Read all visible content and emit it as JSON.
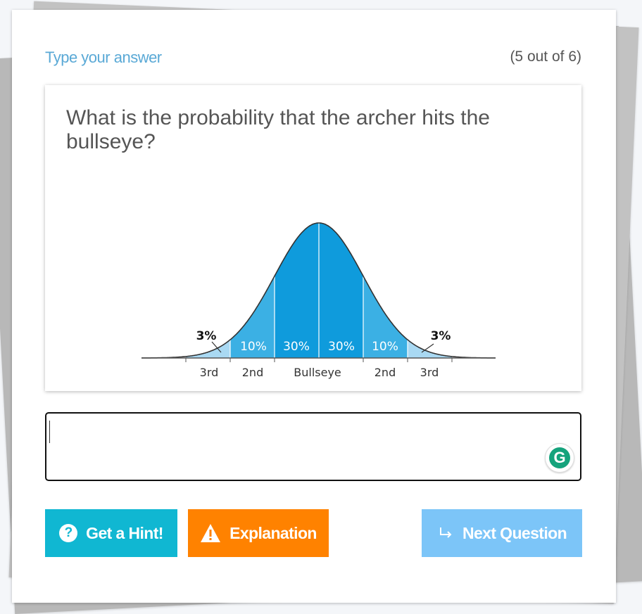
{
  "header": {
    "title": "Type your answer",
    "counter": "(5 out of 6)"
  },
  "question": {
    "text": "What is the probability that the archer hits the bullseye?"
  },
  "chart_data": {
    "type": "area",
    "title": "",
    "segments": [
      {
        "zone": "3rd",
        "percent_label": "3%"
      },
      {
        "zone": "2nd",
        "percent_label": "10%"
      },
      {
        "zone": "Bullseye",
        "percent_label": "30%"
      },
      {
        "zone": "Bullseye",
        "percent_label": "30%"
      },
      {
        "zone": "2nd",
        "percent_label": "10%"
      },
      {
        "zone": "3rd",
        "percent_label": "3%"
      }
    ],
    "zone_labels": [
      "3rd",
      "2nd",
      "Bullseye",
      "2nd",
      "3rd"
    ],
    "colors": {
      "center": "#0f9bdc",
      "second": "#3bb0e4",
      "third": "#a9d9f3",
      "curve": "#333333"
    }
  },
  "answer": {
    "value": "",
    "placeholder": ""
  },
  "buttons": {
    "hint": "Get a Hint!",
    "explanation": "Explanation",
    "next": "Next Question"
  },
  "colors": {
    "hint": "#10b7d2",
    "explanation": "#ff8200",
    "next": "#7cc5f8",
    "accent": "#5aa9d6"
  }
}
